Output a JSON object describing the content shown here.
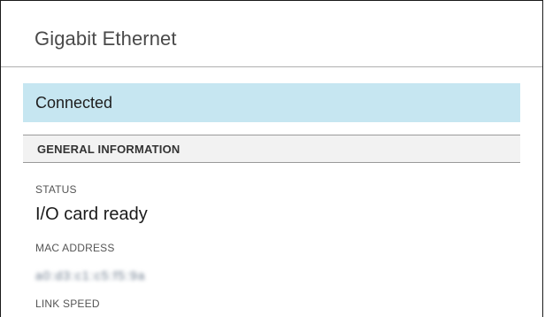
{
  "header": {
    "title": "Gigabit Ethernet"
  },
  "status_banner": {
    "text": "Connected",
    "color": "#c6e6f1"
  },
  "general_information": {
    "section_title": "GENERAL INFORMATION",
    "fields": [
      {
        "label": "STATUS",
        "value": "I/O card ready"
      },
      {
        "label": "MAC ADDRESS",
        "value": "a0:d3:c1:c5:f5:9a"
      },
      {
        "label": "LINK SPEED",
        "value": ""
      }
    ]
  }
}
